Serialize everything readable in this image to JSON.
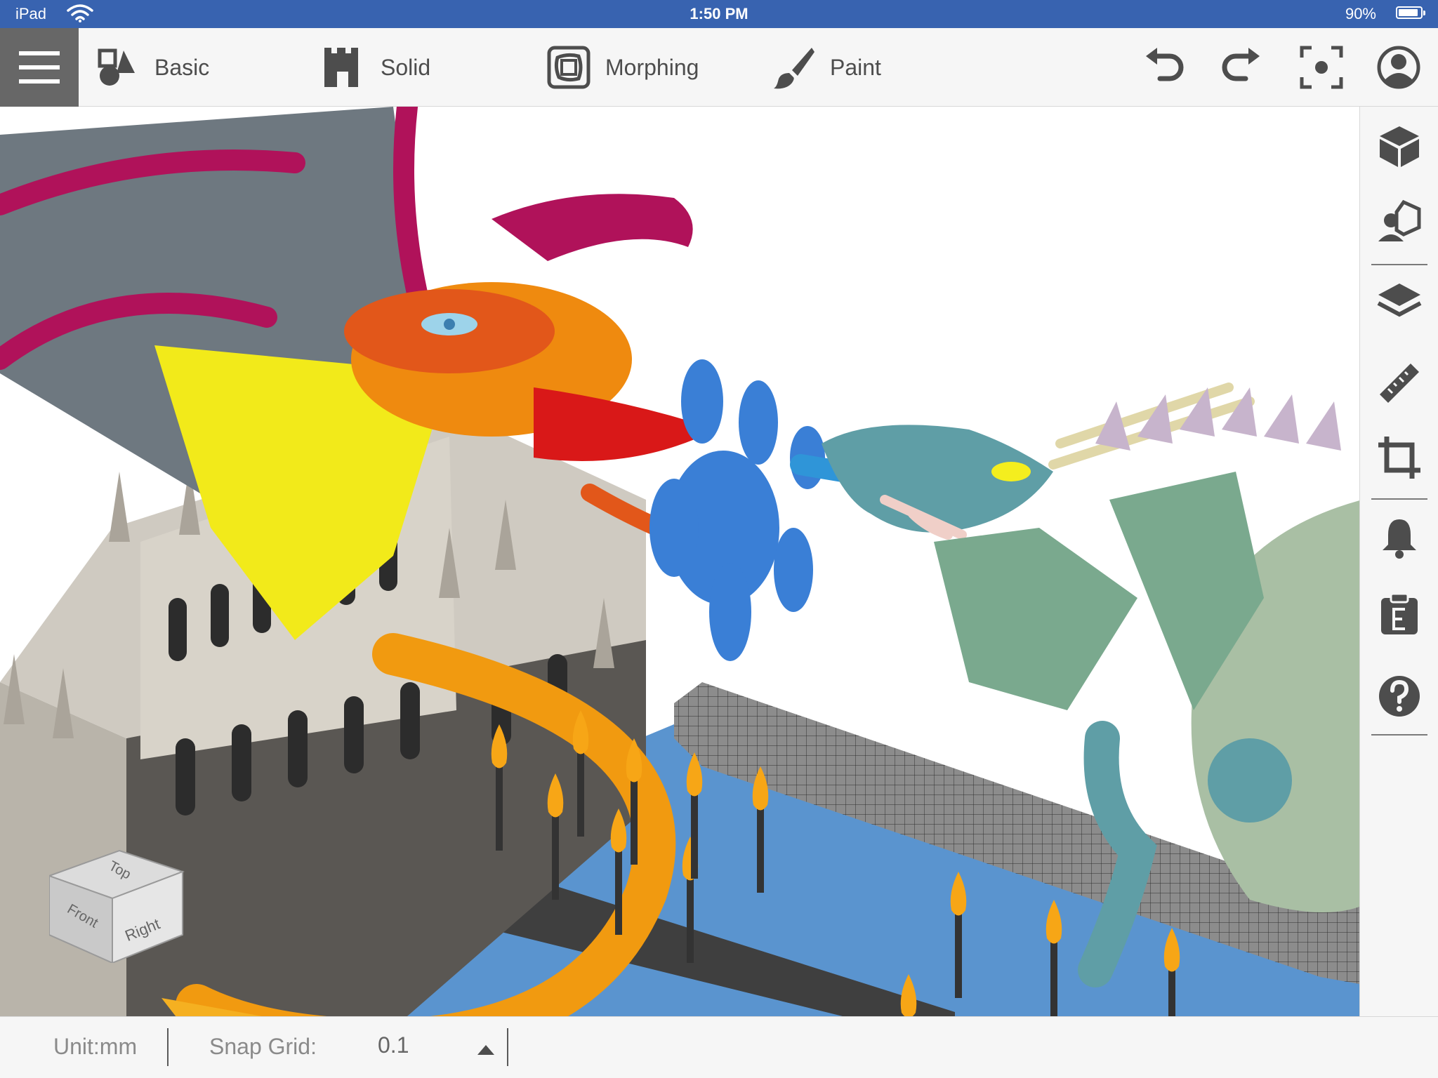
{
  "status_bar": {
    "device": "iPad",
    "time": "1:50 PM",
    "battery_percent": "90%",
    "battery_level": 0.9
  },
  "toolbar": {
    "menu_icon": "hamburger-menu-icon",
    "tabs": [
      {
        "label": "Basic",
        "icon": "basic-shapes-icon"
      },
      {
        "label": "Solid",
        "icon": "castle-tower-icon"
      },
      {
        "label": "Morphing",
        "icon": "morph-square-icon"
      },
      {
        "label": "Paint",
        "icon": "paint-brush-icon"
      }
    ],
    "right_icons": [
      "undo-icon",
      "redo-icon",
      "focus-view-icon",
      "account-icon"
    ]
  },
  "viewport": {
    "view_cube": {
      "top": "Top",
      "front": "Front",
      "right": "Right"
    }
  },
  "sidebar": {
    "icons": [
      "cube-icon",
      "import-model-icon",
      "layers-icon",
      "ruler-icon",
      "crop-icon",
      "notification-bell-icon",
      "export-clipboard-icon",
      "help-icon"
    ]
  },
  "bottom_bar": {
    "unit_label": "Unit:mm",
    "snap_grid_label": "Snap Grid:",
    "snap_grid_value": "0.1"
  },
  "colors": {
    "status_bar": "#3863b0",
    "toolbar_bg": "#f6f6f6",
    "menu_button": "#676767",
    "icon_gray": "#4d4d4d"
  }
}
